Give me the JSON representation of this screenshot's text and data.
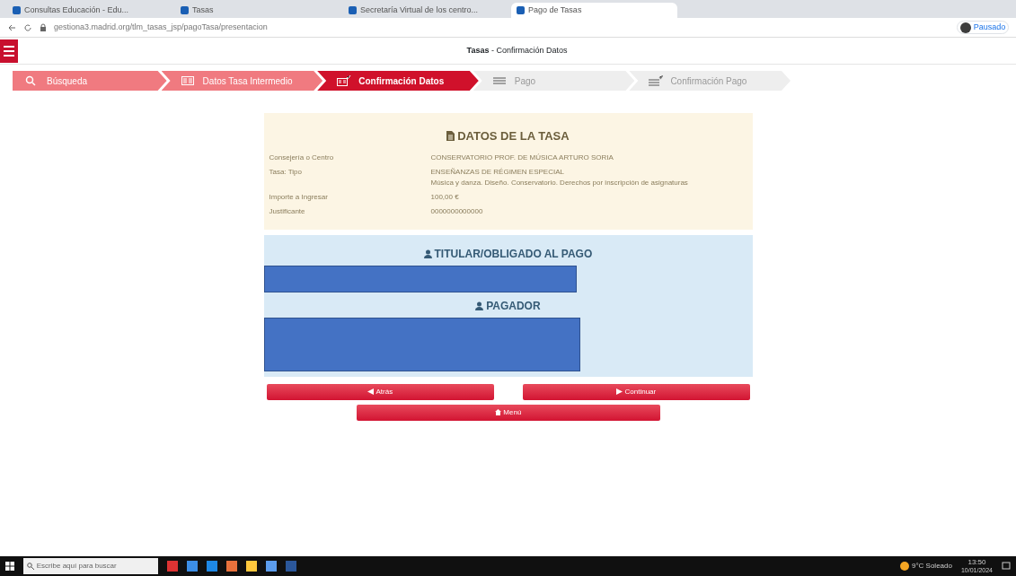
{
  "browser": {
    "tabs": [
      {
        "title": "Consultas Educación - Edu...",
        "selected": false
      },
      {
        "title": "Tasas",
        "selected": false
      },
      {
        "title": "Secretaría Virtual de los centro...",
        "selected": false
      },
      {
        "title": "Pago de Tasas",
        "selected": true
      }
    ],
    "url": "gestiona3.madrid.org/tlm_tasas_jsp/pagoTasa/presentacion",
    "profile_label": "Pausado"
  },
  "header": {
    "title_bold": "Tasas",
    "title_rest": " - Confirmación Datos"
  },
  "steps": [
    {
      "label": "Búsqueda",
      "completed": true,
      "selected": false
    },
    {
      "label": "Datos Tasa Intermedio",
      "completed": true,
      "selected": false
    },
    {
      "label": "Confirmación Datos",
      "completed": false,
      "selected": true
    },
    {
      "label": "Pago",
      "completed": false,
      "selected": false
    },
    {
      "label": "Confirmación Pago",
      "completed": false,
      "selected": false
    }
  ],
  "tasa": {
    "heading": "DATOS DE LA TASA",
    "rows": [
      {
        "label": "Consejería o Centro",
        "values": [
          "CONSERVATORIO PROF. DE MÚSICA ARTURO SORIA"
        ]
      },
      {
        "label": "Tasa: Tipo",
        "values": [
          "ENSEÑANZAS DE RÉGIMEN ESPECIAL",
          "Música y danza. Diseño. Conservatorio. Derechos por inscripción de asignaturas"
        ]
      },
      {
        "label": "Importe a Ingresar",
        "values": [
          "100,00 €"
        ]
      },
      {
        "label": "Justificante",
        "values": [
          "0000000000000"
        ]
      }
    ]
  },
  "persons": {
    "titular_heading": "TITULAR/OBLIGADO AL PAGO",
    "pagador_heading": "PAGADOR"
  },
  "buttons": {
    "back": "Atrás",
    "next": "Continuar",
    "menu": "Menú"
  },
  "taskbar": {
    "search_placeholder": "Escribe aquí para buscar",
    "weather": "9°C Soleado",
    "time": "13:50",
    "date": "10/01/2024"
  }
}
